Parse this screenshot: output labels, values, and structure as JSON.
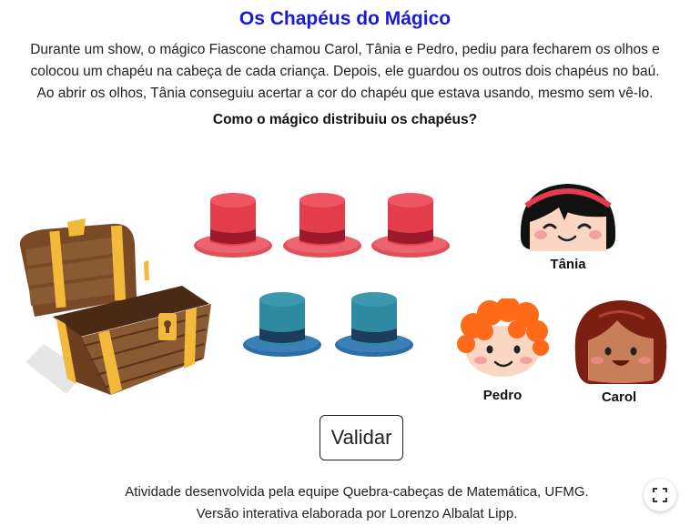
{
  "header": {
    "title": "Os Chapéus do Mágico",
    "description_lines": [
      "Durante um show, o mágico Fiascone chamou Carol, Tânia e Pedro, pediu para fecharem os olhos e",
      "colocou um chapéu na cabeça de cada criança. Depois, ele guardou os outros dois chapéus no baú.",
      "Ao abrir os olhos, Tânia conseguiu acertar a cor do chapéu que estava usando, mesmo sem vê-lo."
    ],
    "question": "Como o mágico distribuiu os chapéus?"
  },
  "hats": [
    {
      "color": "red",
      "hex": "#e0404f"
    },
    {
      "color": "red",
      "hex": "#e0404f"
    },
    {
      "color": "red",
      "hex": "#e0404f"
    },
    {
      "color": "blue",
      "hex": "#2f7fa3"
    },
    {
      "color": "blue",
      "hex": "#2f7fa3"
    }
  ],
  "children": {
    "tania": {
      "name": "Tânia"
    },
    "pedro": {
      "name": "Pedro"
    },
    "carol": {
      "name": "Carol"
    }
  },
  "actions": {
    "validate_label": "Validar"
  },
  "footer": {
    "line1": "Atividade desenvolvida pela equipe Quebra-cabeças de Matemática, UFMG.",
    "line2": "Versão interativa elaborada por Lorenzo Albalat Lipp."
  },
  "icons": {
    "fullscreen": "fullscreen-icon",
    "chest": "treasure-chest"
  }
}
